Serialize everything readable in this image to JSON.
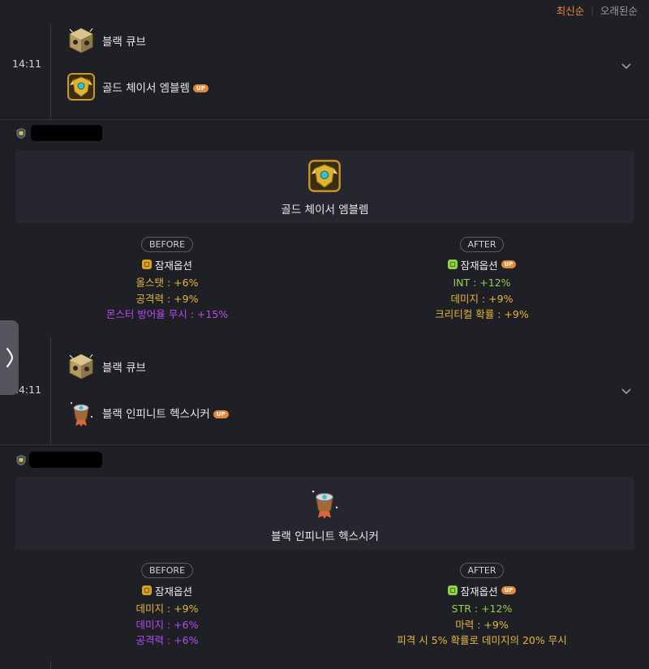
{
  "sort": {
    "latest": "최신순",
    "oldest": "오래된순"
  },
  "log1": {
    "time": "14:11",
    "cube_name": "블랙 큐브",
    "item_name": "골드 체이서 엠블렘",
    "up_badge": "UP"
  },
  "result1": {
    "item_name": "골드 체이서 엠블렘",
    "before": {
      "label": "BEFORE",
      "title": "잠재옵션",
      "grade": "unique",
      "lines": [
        "올스탯 : +6%",
        "공격력 : +9%",
        "몬스터 방어율 무시 : +15%"
      ],
      "colors": [
        "#e7b43c",
        "#e7b43c",
        "#b54bf2"
      ]
    },
    "after": {
      "label": "AFTER",
      "title": "잠재옵션",
      "grade": "legendary",
      "up_badge": "UP",
      "lines": [
        "INT : +12%",
        "데미지 : +9%",
        "크리티컬 확률 : +9%"
      ],
      "colors": [
        "#8fd04a",
        "#e7b43c",
        "#e7b43c"
      ]
    }
  },
  "log2": {
    "time": "14:11",
    "cube_name": "블랙 큐브",
    "item_name": "블랙 인피니트 헥스시커",
    "up_badge": "UP"
  },
  "result2": {
    "item_name": "블랙 인피니트 헥스시커",
    "before": {
      "label": "BEFORE",
      "title": "잠재옵션",
      "grade": "unique",
      "lines": [
        "데미지 : +9%",
        "데미지 : +6%",
        "공격력 : +6%"
      ],
      "colors": [
        "#e7b43c",
        "#b54bf2",
        "#b54bf2"
      ]
    },
    "after": {
      "label": "AFTER",
      "title": "잠재옵션",
      "grade": "legendary",
      "up_badge": "UP",
      "lines": [
        "STR : +12%",
        "마력 : +9%",
        "피격 시 5% 확률로 데미지의 20% 무시"
      ],
      "colors": [
        "#8fd04a",
        "#e7b43c",
        "#e7b43c"
      ]
    }
  },
  "icons": {
    "cube": "black-cube-icon",
    "emblem": "gold-emblem-icon",
    "hexseeker": "hexseeker-icon",
    "chevron": "chevron-down-icon",
    "side_tab": "chevron-right-icon"
  }
}
